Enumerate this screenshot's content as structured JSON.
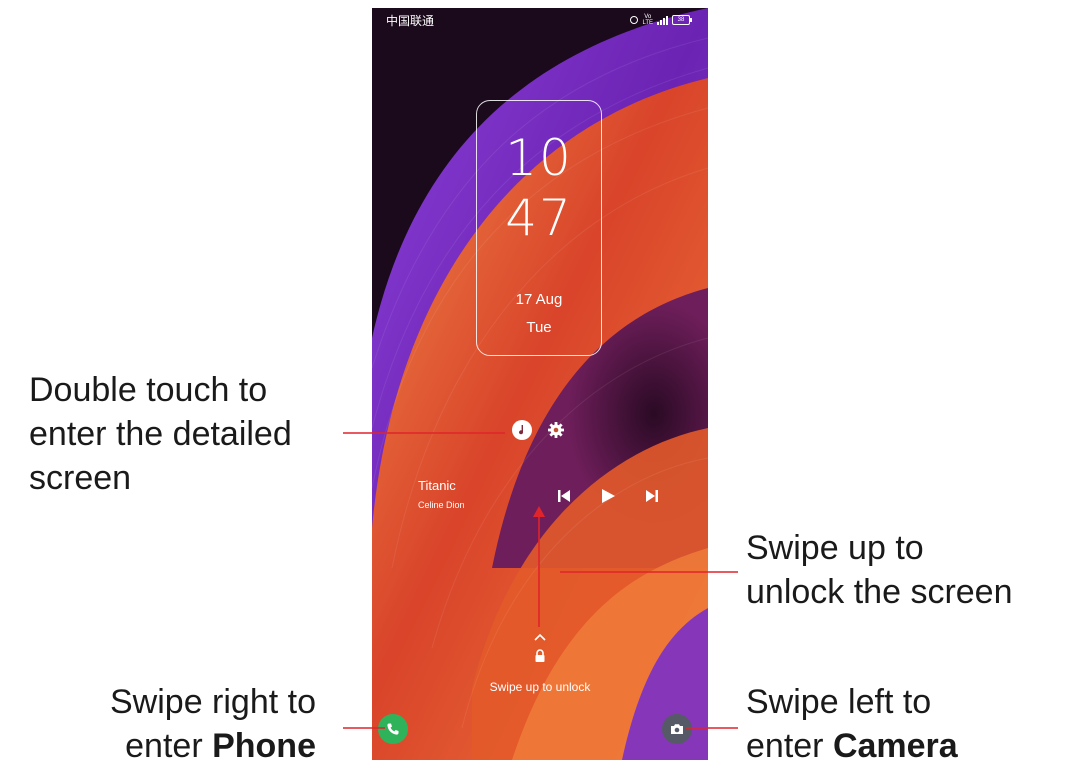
{
  "status_bar": {
    "carrier": "中国联通",
    "volte": "Vo",
    "network": "LTE",
    "battery": "38",
    "icons": [
      "nfc-icon",
      "volte-icon",
      "signal-icon",
      "battery-icon"
    ]
  },
  "clock": {
    "hour": "10",
    "minute": "47",
    "date": "17 Aug",
    "day": "Tue"
  },
  "media": {
    "title": "Titanic",
    "artist": "Celine Dion",
    "controls": [
      "previous-icon",
      "play-icon",
      "next-icon"
    ]
  },
  "lock": {
    "hint": "Swipe up to unlock"
  },
  "shortcuts": {
    "left": "phone-icon",
    "right": "camera-icon"
  },
  "callouts": {
    "detail": {
      "line1": "Double touch to",
      "line2": "enter the detailed",
      "line3": "screen"
    },
    "unlock": {
      "line1": "Swipe up to",
      "line2": "unlock the screen"
    },
    "phone": {
      "line1": "Swipe right to",
      "line2_prefix": "enter ",
      "line2_bold": "Phone"
    },
    "camera": {
      "line1": "Swipe left to",
      "line2_prefix": "enter ",
      "line2_bold": "Camera"
    }
  },
  "colors": {
    "callout_line": "#e0242a",
    "phone_button": "#2fb35a",
    "camera_button": "#555a66",
    "wallpaper_orange": "#e8652e",
    "wallpaper_purple": "#7b2fc0"
  }
}
